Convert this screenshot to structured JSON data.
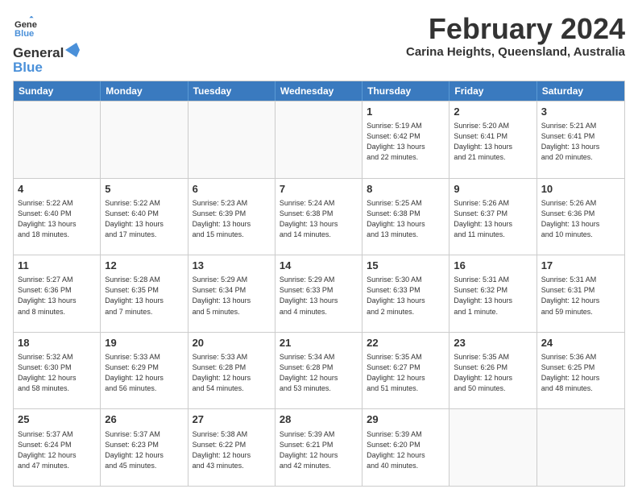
{
  "logo": {
    "line1": "General",
    "line2": "Blue",
    "icon_color": "#4a90d9"
  },
  "title": "February 2024",
  "subtitle": "Carina Heights, Queensland, Australia",
  "days_of_week": [
    "Sunday",
    "Monday",
    "Tuesday",
    "Wednesday",
    "Thursday",
    "Friday",
    "Saturday"
  ],
  "weeks": [
    [
      {
        "day": "",
        "empty": true
      },
      {
        "day": "",
        "empty": true
      },
      {
        "day": "",
        "empty": true
      },
      {
        "day": "",
        "empty": true
      },
      {
        "day": "1",
        "info": "Sunrise: 5:19 AM\nSunset: 6:42 PM\nDaylight: 13 hours\nand 22 minutes."
      },
      {
        "day": "2",
        "info": "Sunrise: 5:20 AM\nSunset: 6:41 PM\nDaylight: 13 hours\nand 21 minutes."
      },
      {
        "day": "3",
        "info": "Sunrise: 5:21 AM\nSunset: 6:41 PM\nDaylight: 13 hours\nand 20 minutes."
      }
    ],
    [
      {
        "day": "4",
        "info": "Sunrise: 5:22 AM\nSunset: 6:40 PM\nDaylight: 13 hours\nand 18 minutes."
      },
      {
        "day": "5",
        "info": "Sunrise: 5:22 AM\nSunset: 6:40 PM\nDaylight: 13 hours\nand 17 minutes."
      },
      {
        "day": "6",
        "info": "Sunrise: 5:23 AM\nSunset: 6:39 PM\nDaylight: 13 hours\nand 15 minutes."
      },
      {
        "day": "7",
        "info": "Sunrise: 5:24 AM\nSunset: 6:38 PM\nDaylight: 13 hours\nand 14 minutes."
      },
      {
        "day": "8",
        "info": "Sunrise: 5:25 AM\nSunset: 6:38 PM\nDaylight: 13 hours\nand 13 minutes."
      },
      {
        "day": "9",
        "info": "Sunrise: 5:26 AM\nSunset: 6:37 PM\nDaylight: 13 hours\nand 11 minutes."
      },
      {
        "day": "10",
        "info": "Sunrise: 5:26 AM\nSunset: 6:36 PM\nDaylight: 13 hours\nand 10 minutes."
      }
    ],
    [
      {
        "day": "11",
        "info": "Sunrise: 5:27 AM\nSunset: 6:36 PM\nDaylight: 13 hours\nand 8 minutes."
      },
      {
        "day": "12",
        "info": "Sunrise: 5:28 AM\nSunset: 6:35 PM\nDaylight: 13 hours\nand 7 minutes."
      },
      {
        "day": "13",
        "info": "Sunrise: 5:29 AM\nSunset: 6:34 PM\nDaylight: 13 hours\nand 5 minutes."
      },
      {
        "day": "14",
        "info": "Sunrise: 5:29 AM\nSunset: 6:33 PM\nDaylight: 13 hours\nand 4 minutes."
      },
      {
        "day": "15",
        "info": "Sunrise: 5:30 AM\nSunset: 6:33 PM\nDaylight: 13 hours\nand 2 minutes."
      },
      {
        "day": "16",
        "info": "Sunrise: 5:31 AM\nSunset: 6:32 PM\nDaylight: 13 hours\nand 1 minute."
      },
      {
        "day": "17",
        "info": "Sunrise: 5:31 AM\nSunset: 6:31 PM\nDaylight: 12 hours\nand 59 minutes."
      }
    ],
    [
      {
        "day": "18",
        "info": "Sunrise: 5:32 AM\nSunset: 6:30 PM\nDaylight: 12 hours\nand 58 minutes."
      },
      {
        "day": "19",
        "info": "Sunrise: 5:33 AM\nSunset: 6:29 PM\nDaylight: 12 hours\nand 56 minutes."
      },
      {
        "day": "20",
        "info": "Sunrise: 5:33 AM\nSunset: 6:28 PM\nDaylight: 12 hours\nand 54 minutes."
      },
      {
        "day": "21",
        "info": "Sunrise: 5:34 AM\nSunset: 6:28 PM\nDaylight: 12 hours\nand 53 minutes."
      },
      {
        "day": "22",
        "info": "Sunrise: 5:35 AM\nSunset: 6:27 PM\nDaylight: 12 hours\nand 51 minutes."
      },
      {
        "day": "23",
        "info": "Sunrise: 5:35 AM\nSunset: 6:26 PM\nDaylight: 12 hours\nand 50 minutes."
      },
      {
        "day": "24",
        "info": "Sunrise: 5:36 AM\nSunset: 6:25 PM\nDaylight: 12 hours\nand 48 minutes."
      }
    ],
    [
      {
        "day": "25",
        "info": "Sunrise: 5:37 AM\nSunset: 6:24 PM\nDaylight: 12 hours\nand 47 minutes."
      },
      {
        "day": "26",
        "info": "Sunrise: 5:37 AM\nSunset: 6:23 PM\nDaylight: 12 hours\nand 45 minutes."
      },
      {
        "day": "27",
        "info": "Sunrise: 5:38 AM\nSunset: 6:22 PM\nDaylight: 12 hours\nand 43 minutes."
      },
      {
        "day": "28",
        "info": "Sunrise: 5:39 AM\nSunset: 6:21 PM\nDaylight: 12 hours\nand 42 minutes."
      },
      {
        "day": "29",
        "info": "Sunrise: 5:39 AM\nSunset: 6:20 PM\nDaylight: 12 hours\nand 40 minutes."
      },
      {
        "day": "",
        "empty": true
      },
      {
        "day": "",
        "empty": true
      }
    ]
  ]
}
